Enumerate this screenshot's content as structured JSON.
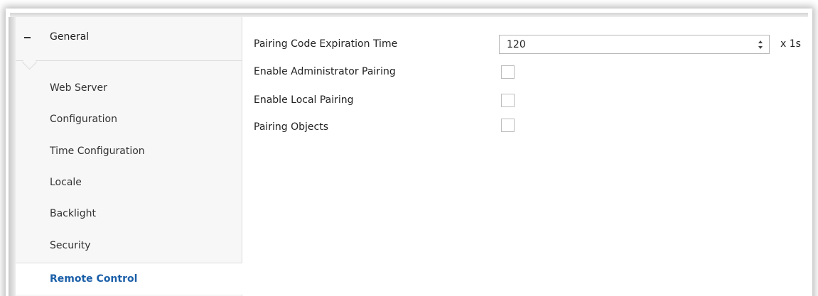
{
  "sidebar": {
    "section": {
      "title": "General",
      "toggle_icon": "minus-icon"
    },
    "items": [
      {
        "label": "Web Server",
        "active": false
      },
      {
        "label": "Configuration",
        "active": false
      },
      {
        "label": "Time Configuration",
        "active": false
      },
      {
        "label": "Locale",
        "active": false
      },
      {
        "label": "Backlight",
        "active": false
      },
      {
        "label": "Security",
        "active": false
      },
      {
        "label": "Remote Control",
        "active": true
      }
    ]
  },
  "content": {
    "pairing_code_expiration": {
      "label": "Pairing Code Expiration Time",
      "value": "120",
      "unit": "x 1s"
    },
    "enable_administrator_pairing": {
      "label": "Enable Administrator Pairing",
      "checked": false
    },
    "enable_local_pairing": {
      "label": "Enable Local Pairing",
      "checked": false
    },
    "pairing_objects": {
      "label": "Pairing Objects",
      "checked": false
    }
  },
  "colors": {
    "active_item_text": "#1b5fa8",
    "sidebar_background": "#f7f7f7",
    "border": "#dcdcdc"
  }
}
